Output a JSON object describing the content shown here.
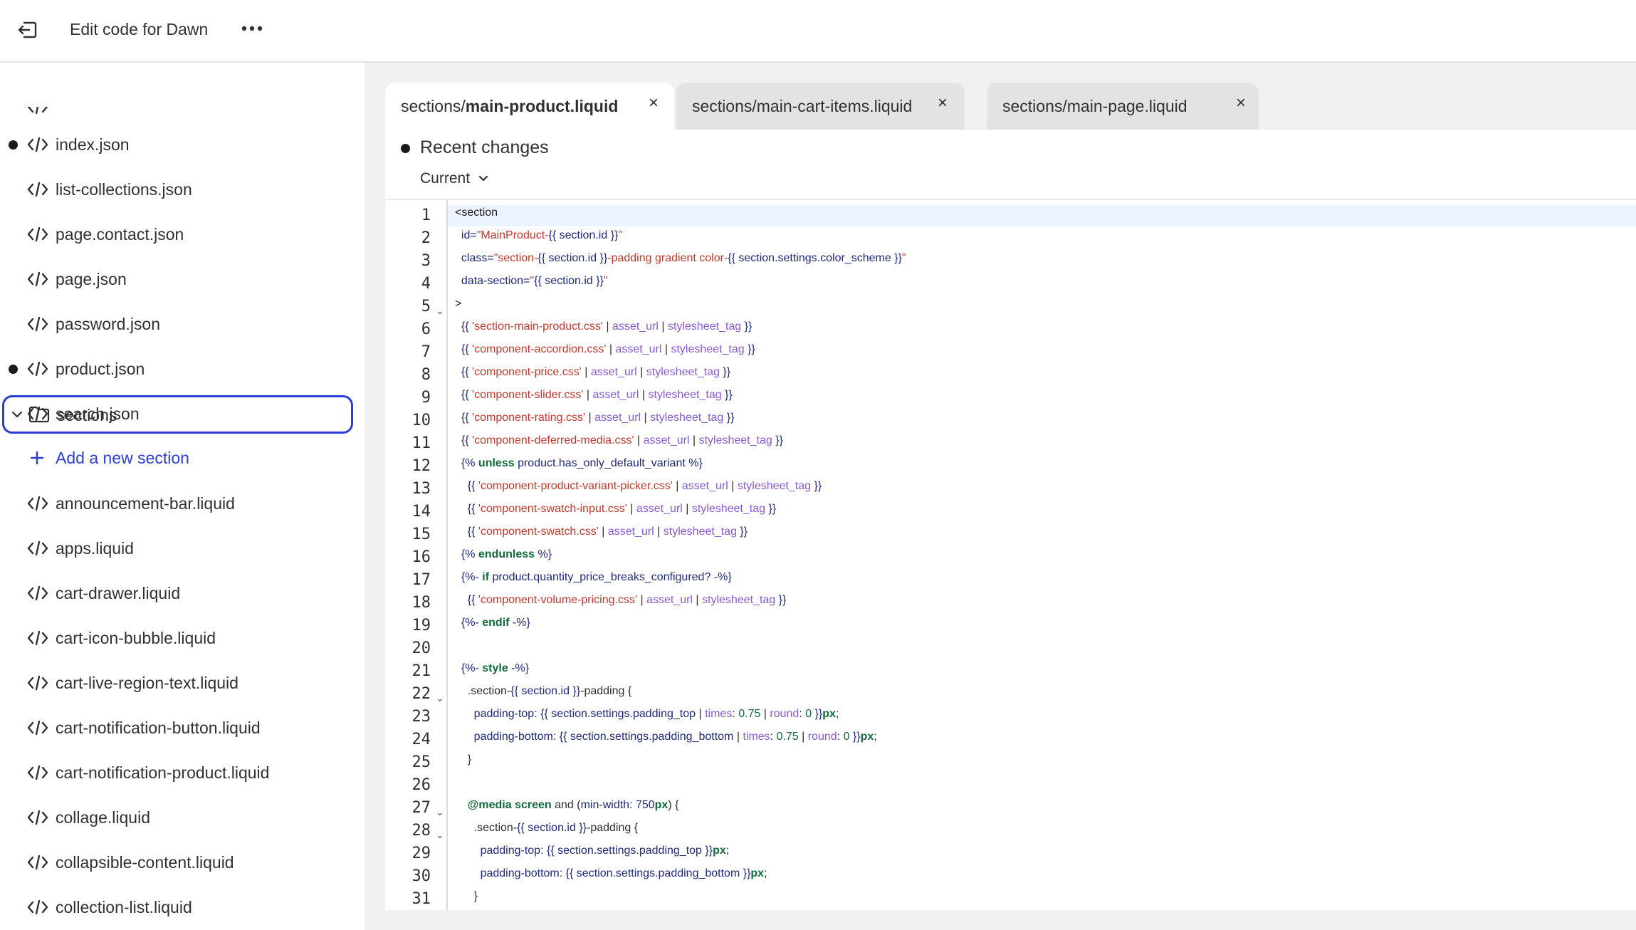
{
  "header": {
    "exit_icon": "exit-icon",
    "title": "Edit code for Dawn",
    "more_icon": "more-dots-icon"
  },
  "sidebar": {
    "items_before": [
      {
        "label": "index.json",
        "modified": true
      },
      {
        "label": "list-collections.json",
        "modified": false
      },
      {
        "label": "page.contact.json",
        "modified": false
      },
      {
        "label": "page.json",
        "modified": false
      },
      {
        "label": "password.json",
        "modified": false
      },
      {
        "label": "product.json",
        "modified": true
      },
      {
        "label": "search.json",
        "modified": false
      }
    ],
    "folder": {
      "label": "sections",
      "icon": "folder-icon",
      "expanded": true
    },
    "add_label": "Add a new section",
    "items_after": [
      {
        "label": "announcement-bar.liquid"
      },
      {
        "label": "apps.liquid"
      },
      {
        "label": "cart-drawer.liquid"
      },
      {
        "label": "cart-icon-bubble.liquid"
      },
      {
        "label": "cart-live-region-text.liquid"
      },
      {
        "label": "cart-notification-button.liquid"
      },
      {
        "label": "cart-notification-product.liquid"
      },
      {
        "label": "collage.liquid"
      },
      {
        "label": "collapsible-content.liquid"
      },
      {
        "label": "collection-list.liquid"
      }
    ]
  },
  "tabs": [
    {
      "prefix": "sections/",
      "name": "main-product.liquid",
      "active": true
    },
    {
      "prefix": "",
      "name": "sections/main-cart-items.liquid",
      "active": false
    },
    {
      "prefix": "",
      "name": "sections/main-page.liquid",
      "active": false
    }
  ],
  "changes": {
    "title": "Recent changes",
    "version": "Current"
  },
  "editor": {
    "line_numbers": [
      "1",
      "2",
      "3",
      "4",
      "5",
      "6",
      "7",
      "8",
      "9",
      "10",
      "11",
      "12",
      "13",
      "14",
      "15",
      "16",
      "17",
      "18",
      "19",
      "20",
      "21",
      "22",
      "23",
      "24",
      "25",
      "26",
      "27",
      "28",
      "29",
      "30",
      "31"
    ],
    "fold_lines": [
      "5",
      "22",
      "27",
      "28"
    ]
  }
}
